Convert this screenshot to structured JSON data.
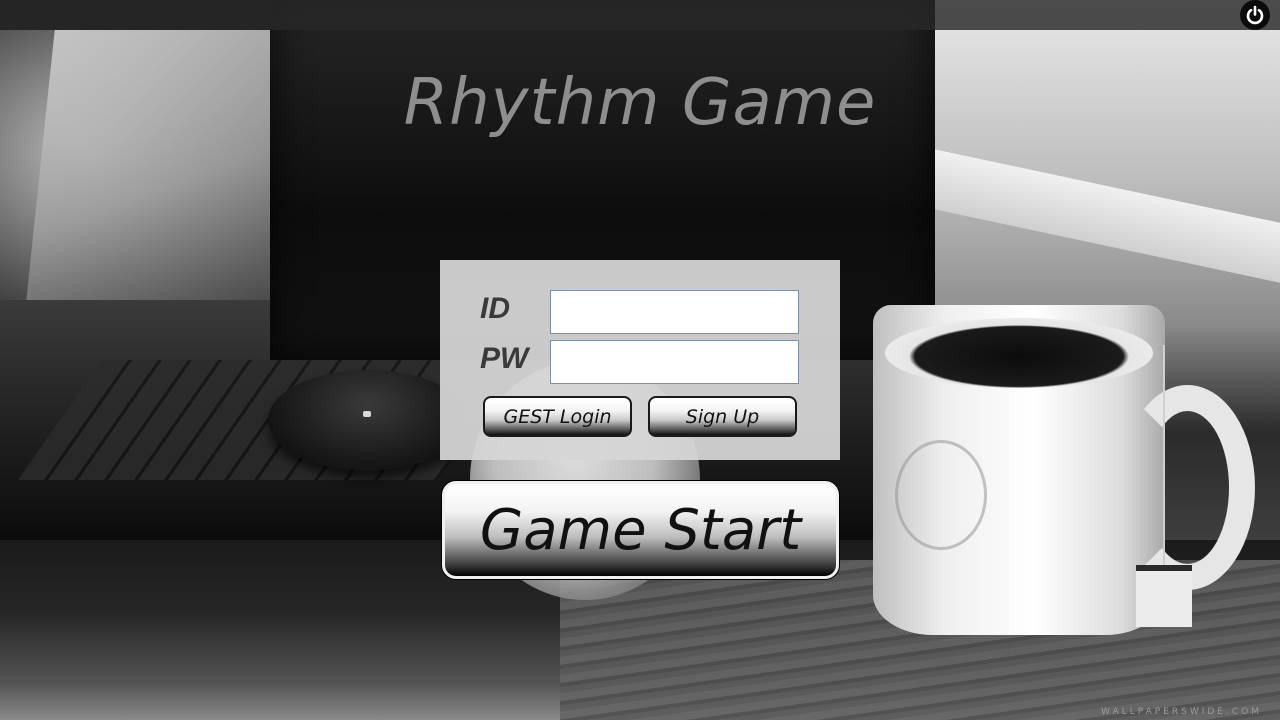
{
  "app": {
    "title": "Rhythm Game"
  },
  "top_bar": {
    "power_icon": "power-icon"
  },
  "login": {
    "id_label": "ID",
    "pw_label": "PW",
    "id_value": "",
    "pw_value": "",
    "guest_login_label": "GEST Login",
    "sign_up_label": "Sign Up"
  },
  "start": {
    "label": "Game Start"
  },
  "background": {
    "watermark": "WALLPAPERSWIDE.COM"
  },
  "colors": {
    "title": "#8e8e8e",
    "panel": "#d6d6d6",
    "top_bar": "#282828"
  }
}
